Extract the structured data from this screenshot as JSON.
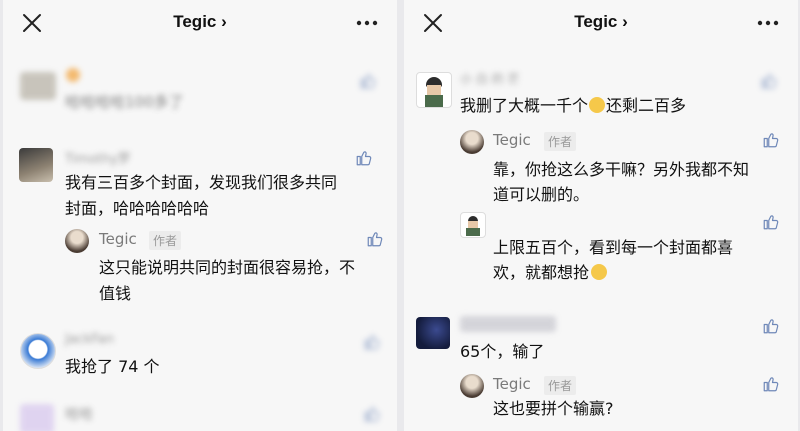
{
  "left": {
    "title": "Tegic",
    "blur_comment_top": "哈哈哈哈100多了",
    "comment1": {
      "name": "Timothy罗",
      "text_line1": "我有三百多个封面，发现我们很多共同",
      "text_line2": "封面，哈哈哈哈哈哈"
    },
    "reply1": {
      "name": "Tegic",
      "badge": "作者",
      "text_line1": "这只能说明共同的封面很容易抢，不",
      "text_line2": "值钱"
    },
    "comment2": {
      "name": "JackFan",
      "text": "我抢了 74 个"
    },
    "blur_comment_bottom": "哈哈"
  },
  "right": {
    "title": "Tegic",
    "comment1": {
      "name": "小 白 的 芒",
      "text": "我删了大概一千个",
      "text_after_emoji": "还剩二百多"
    },
    "reply1": {
      "name": "Tegic",
      "badge": "作者",
      "text_line1": "靠，你抢这么多干嘛？另外我都不知",
      "text_line2": "道可以删的。"
    },
    "reply2": {
      "text_line1": "上限五百个，看到每一个封面都喜",
      "text_line2": "欢，就都想抢"
    },
    "comment2": {
      "text": "65个，输了"
    },
    "reply3": {
      "name": "Tegic",
      "badge": "作者",
      "text": "这也要拼个输赢?"
    }
  },
  "icons": {
    "close": "close-icon",
    "more": "more-dots-icon",
    "like": "thumbs-up-icon"
  },
  "colors": {
    "like": "#6f88b8",
    "background": "#f7f7f7"
  }
}
